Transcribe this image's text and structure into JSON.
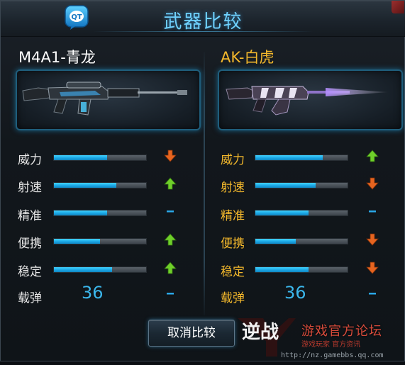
{
  "dialog": {
    "title": "武器比较",
    "cancel_label": "取消比较"
  },
  "left_weapon": {
    "name": "M4A1-青龙",
    "name_color": "#ffffff",
    "stats": [
      {
        "label": "威力",
        "level": 0.58,
        "trend": "down"
      },
      {
        "label": "射速",
        "level": 0.68,
        "trend": "up"
      },
      {
        "label": "精准",
        "level": 0.58,
        "trend": "same"
      },
      {
        "label": "便携",
        "level": 0.5,
        "trend": "up"
      },
      {
        "label": "稳定",
        "level": 0.63,
        "trend": "up"
      }
    ],
    "ammo_label": "载弹",
    "ammo_value": "36",
    "ammo_trend": "same"
  },
  "right_weapon": {
    "name": "AK-白虎",
    "name_color": "#f3b82c",
    "stats": [
      {
        "label": "威力",
        "level": 0.73,
        "trend": "up"
      },
      {
        "label": "射速",
        "level": 0.65,
        "trend": "down"
      },
      {
        "label": "精准",
        "level": 0.58,
        "trend": "same"
      },
      {
        "label": "便携",
        "level": 0.44,
        "trend": "down"
      },
      {
        "label": "稳定",
        "level": 0.58,
        "trend": "down"
      }
    ],
    "ammo_label": "载弹",
    "ammo_value": "36",
    "ammo_trend": "same"
  },
  "icons": {
    "qt": "qt-icon",
    "up": "up-arrow-icon",
    "down": "down-arrow-icon",
    "same": "dash-icon"
  },
  "colors": {
    "title": "#6fd2ff",
    "bar_fill": "#1aa6e4",
    "up": "#6fcf2a",
    "down": "#e6641f",
    "same": "#2aa8e8",
    "ammo": "#3bb7ec"
  },
  "watermark": {
    "logo_text": "逆战",
    "forum": "游戏官方论坛",
    "tag": "游戏玩家 官方资讯",
    "url": "http://nz.gamebbs.qq.com"
  }
}
